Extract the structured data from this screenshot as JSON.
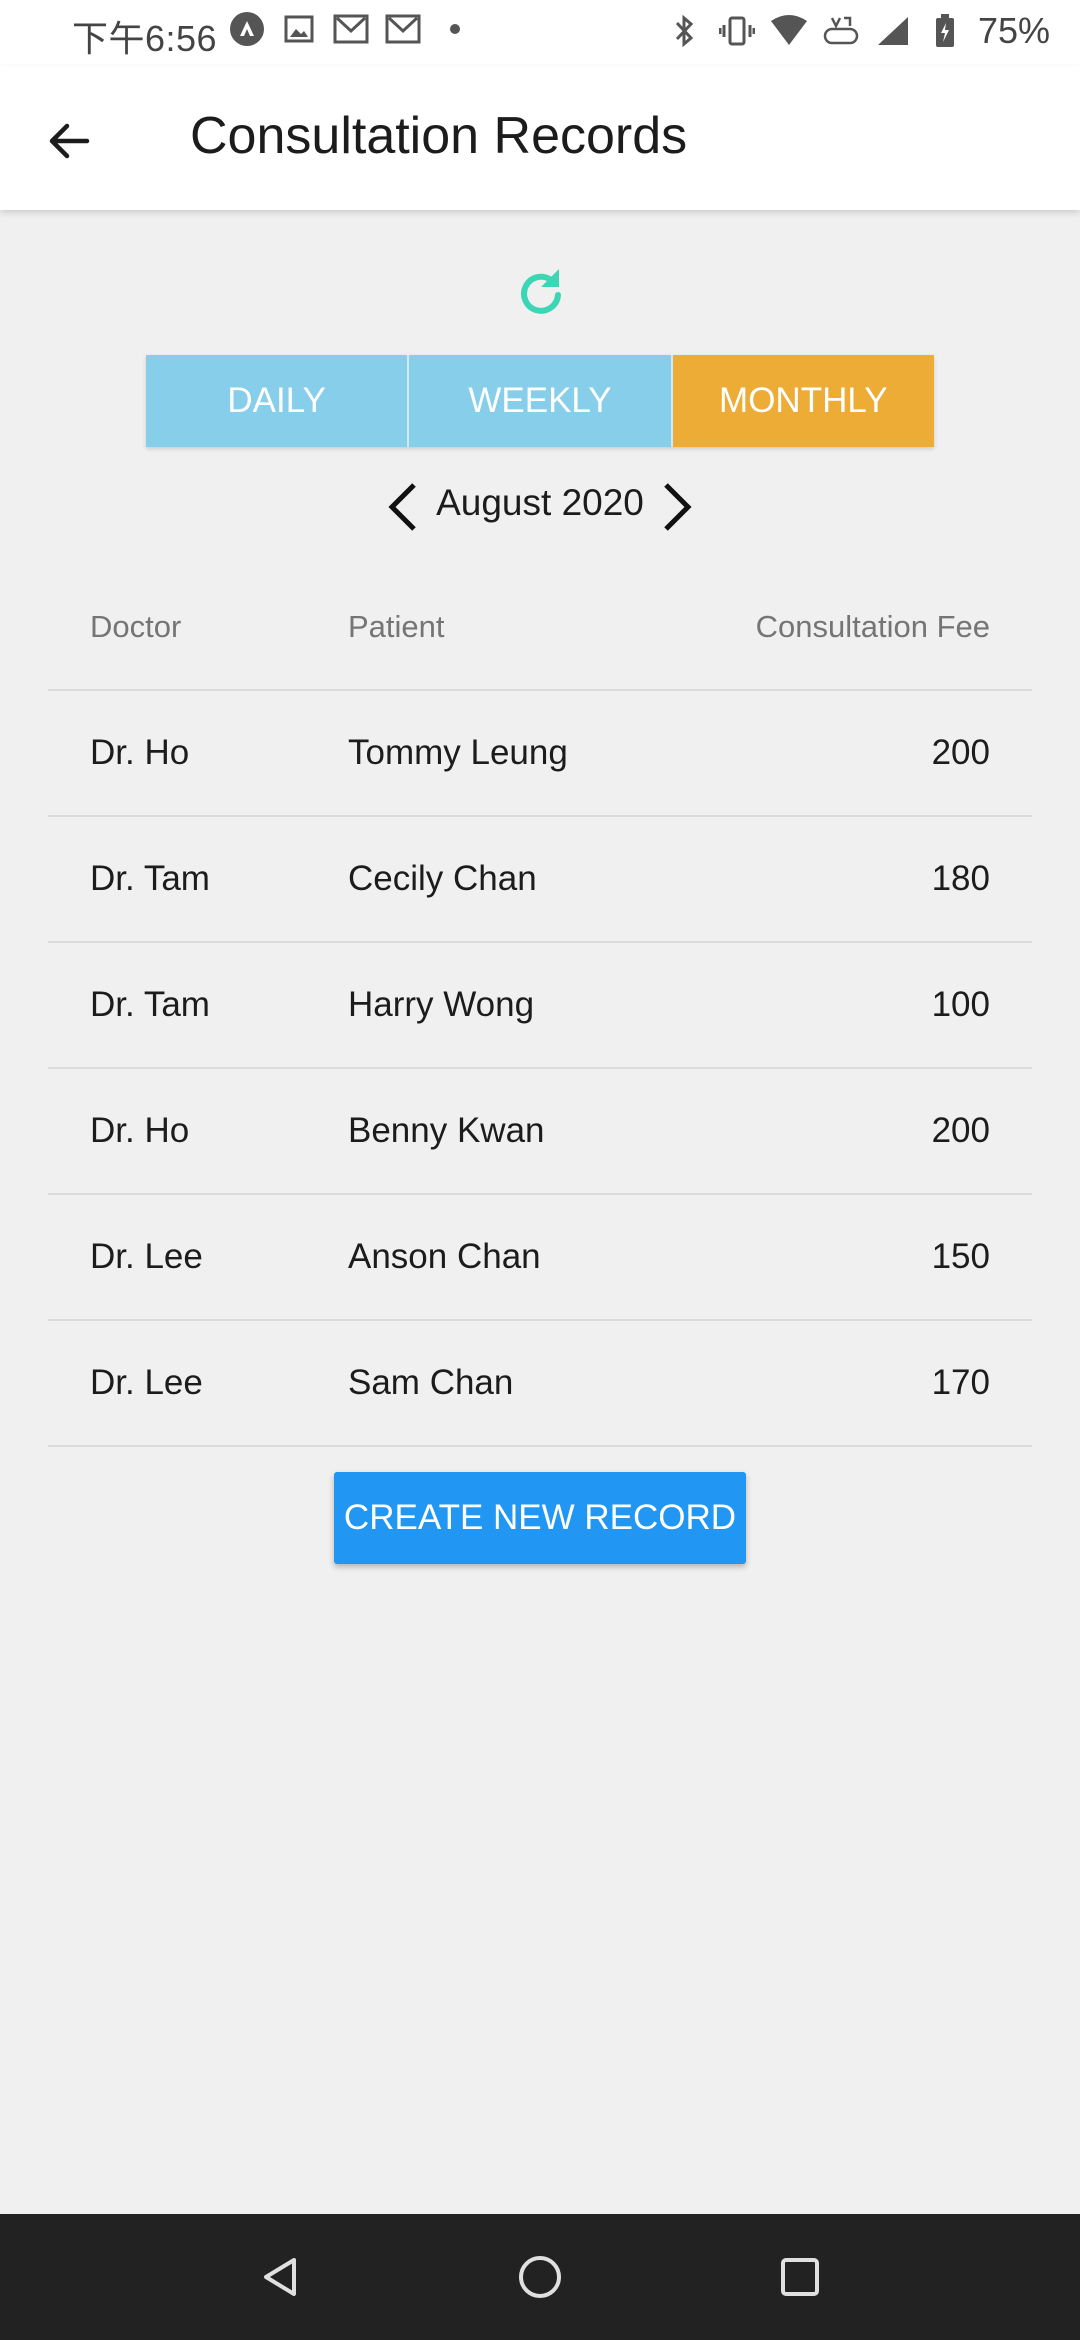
{
  "status_bar": {
    "time": "下午6:56",
    "battery": "75%",
    "left_icons": [
      "nav-app-icon",
      "image-icon",
      "gmail-icon",
      "gmail-icon",
      "dot-icon"
    ],
    "right_icons": [
      "bluetooth-icon",
      "vibrate-icon",
      "wifi-icon",
      "volte-icon",
      "signal-icon",
      "battery-icon"
    ]
  },
  "app_bar": {
    "title": "Consultation Records",
    "back_icon": "arrow-left-icon"
  },
  "colors": {
    "refresh": "#3dd6b5",
    "segment_inactive": "#87ceeb",
    "segment_active": "#edac36",
    "primary_button": "#2196f3",
    "nav_bar": "#222222"
  },
  "period_tabs": {
    "daily": "DAILY",
    "weekly": "WEEKLY",
    "monthly": "MONTHLY",
    "selected": "MONTHLY"
  },
  "month_nav": {
    "label": "August 2020"
  },
  "table": {
    "headers": {
      "doctor": "Doctor",
      "patient": "Patient",
      "fee": "Consultation Fee"
    },
    "rows": [
      {
        "doctor": "Dr. Ho",
        "patient": "Tommy Leung",
        "fee": "200"
      },
      {
        "doctor": "Dr. Tam",
        "patient": "Cecily Chan",
        "fee": "180"
      },
      {
        "doctor": "Dr. Tam",
        "patient": "Harry Wong",
        "fee": "100"
      },
      {
        "doctor": "Dr. Ho",
        "patient": "Benny Kwan",
        "fee": "200"
      },
      {
        "doctor": "Dr. Lee",
        "patient": "Anson Chan",
        "fee": "150"
      },
      {
        "doctor": "Dr. Lee",
        "patient": "Sam Chan",
        "fee": "170"
      }
    ]
  },
  "actions": {
    "create": "CREATE NEW RECORD"
  }
}
